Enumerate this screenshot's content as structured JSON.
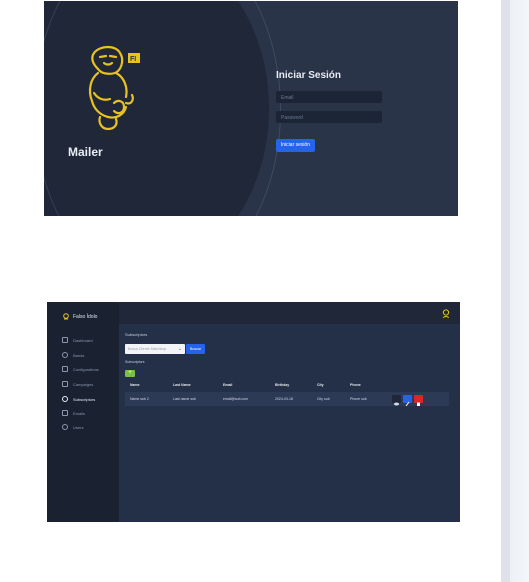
{
  "login": {
    "app_name": "Mailer",
    "title": "Iniciar Sesión",
    "email_placeholder": "Email",
    "password_placeholder": "Password",
    "submit_label": "Iniciar sesión",
    "logo_badge": "FI"
  },
  "dashboard": {
    "brand": "Falso Ídolo",
    "menu": [
      {
        "label": "Dashboard",
        "icon": "home-icon"
      },
      {
        "label": "Bands",
        "icon": "music-icon"
      },
      {
        "label": "Configurations",
        "icon": "tag-icon"
      },
      {
        "label": "Campaigns",
        "icon": "document-icon"
      },
      {
        "label": "Subscriptors",
        "icon": "users-icon",
        "active": true
      },
      {
        "label": "Emails",
        "icon": "mail-icon"
      },
      {
        "label": "Users",
        "icon": "user-icon"
      }
    ],
    "page_title": "Subscriptors",
    "search_placeholder": "Busca Cliente Mailchimp",
    "search_button": "Buscar",
    "section_label": "Subscriptors",
    "add_label": "+",
    "columns": [
      "Name",
      "Last Name",
      "Email",
      "Birthday",
      "City",
      "Phone"
    ],
    "rows": [
      [
        "Name sub 2",
        "Last name sub",
        "email@sub.com",
        "2024-03-18",
        "City sub",
        "Phone sub"
      ]
    ],
    "colors": {
      "view": "#1f2738",
      "edit": "#2563eb",
      "delete": "#dc2626",
      "add": "#7ac143"
    }
  }
}
